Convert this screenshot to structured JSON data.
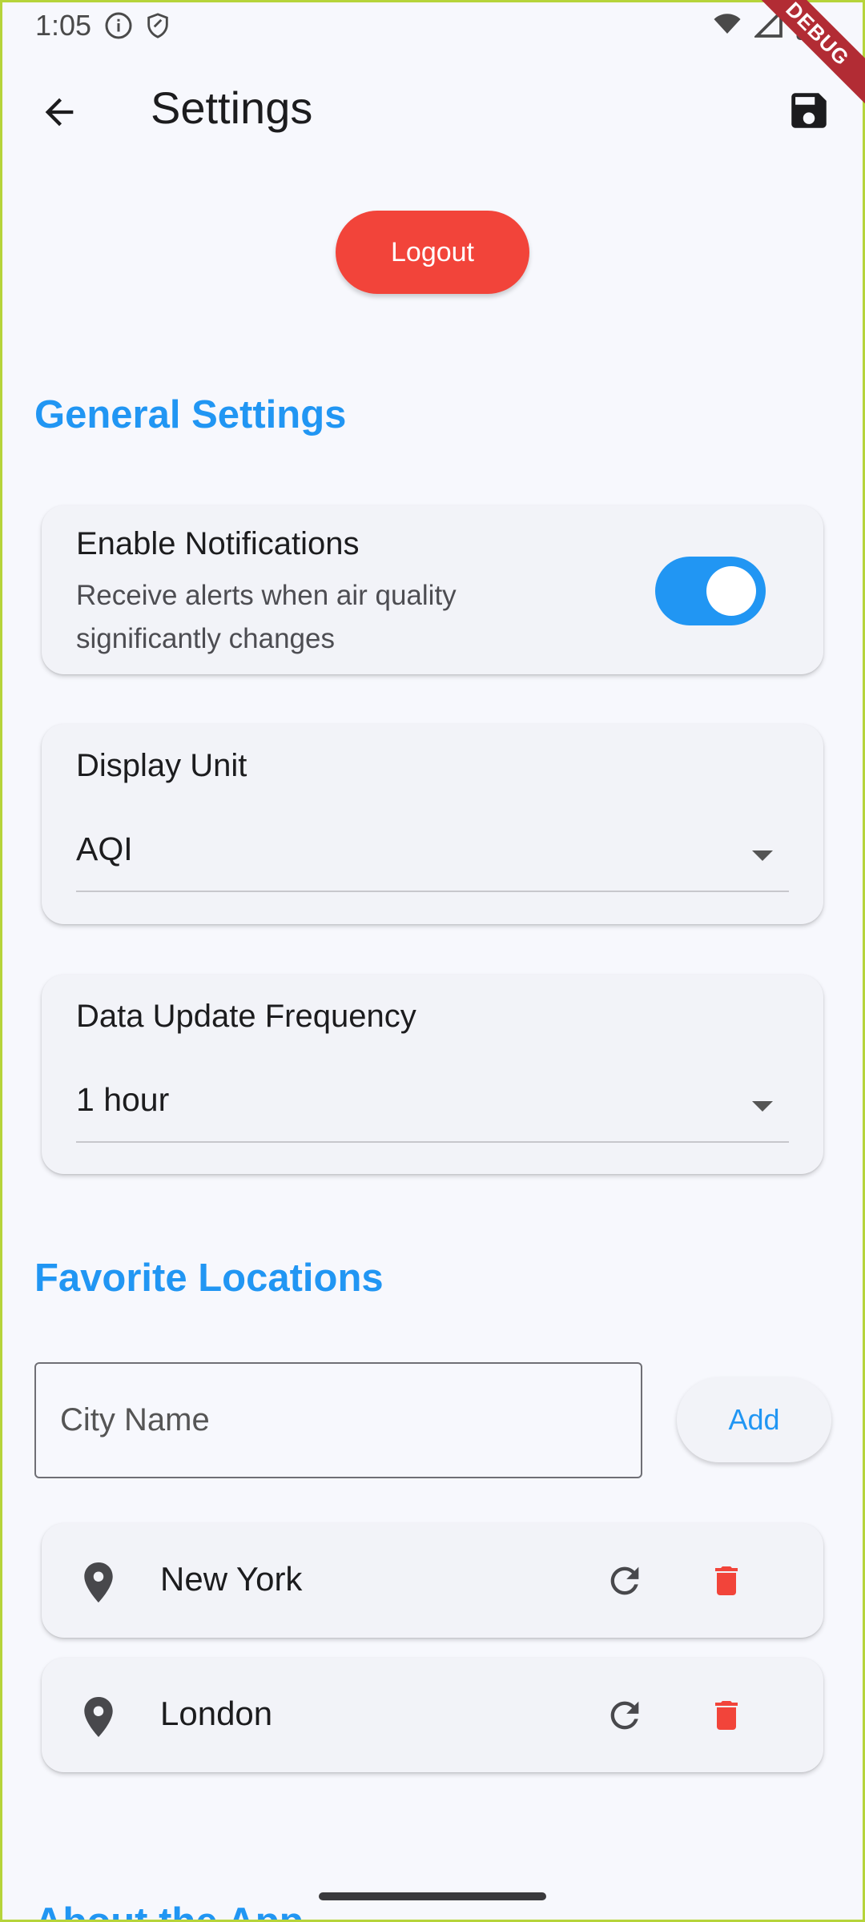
{
  "status_bar": {
    "time": "1:05",
    "icons": [
      "info-icon",
      "shield-icon",
      "wifi-icon",
      "signal-icon",
      "battery-icon"
    ]
  },
  "debug_banner": "DEBUG",
  "app_bar": {
    "title": "Settings",
    "back_icon": "arrow-back-icon",
    "save_icon": "save-icon"
  },
  "logout_label": "Logout",
  "general": {
    "title": "General Settings",
    "notifications": {
      "title": "Enable Notifications",
      "subtitle": "Receive alerts when air quality significantly changes",
      "enabled": true
    },
    "display_unit": {
      "label": "Display Unit",
      "value": "AQI"
    },
    "update_frequency": {
      "label": "Data Update Frequency",
      "value": "1 hour"
    }
  },
  "favorites": {
    "title": "Favorite Locations",
    "input_placeholder": "City Name",
    "add_label": "Add",
    "locations": [
      {
        "name": "New York"
      },
      {
        "name": "London"
      }
    ]
  },
  "about": {
    "title": "About the App"
  },
  "colors": {
    "accent": "#2196f3",
    "danger": "#f2443a",
    "background": "#f7f8fd",
    "card": "#f2f3f8"
  }
}
